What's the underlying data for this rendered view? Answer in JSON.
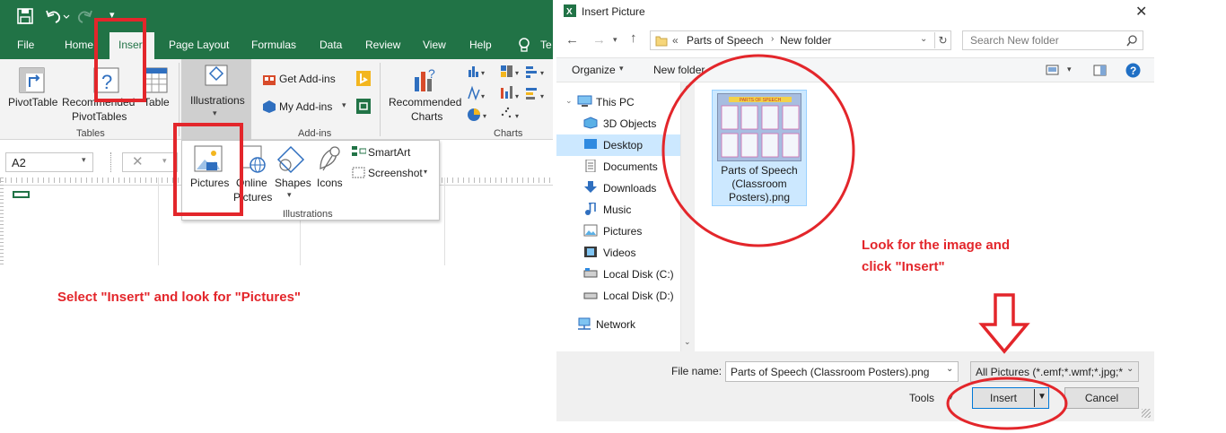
{
  "excel": {
    "tabs": {
      "file": "File",
      "home": "Home",
      "insert": "Insert",
      "page_layout": "Page Layout",
      "formulas": "Formulas",
      "data": "Data",
      "review": "Review",
      "view": "View",
      "help": "Help",
      "tell_me": "Te"
    },
    "ribbon": {
      "pivot_table": "PivotTable",
      "recommended_pivot_line1": "Recommended",
      "recommended_pivot_line2": "PivotTables",
      "table": "Table",
      "tables_group": "Tables",
      "illustrations": "Illustrations",
      "get_addins": "Get Add-ins",
      "my_addins": "My Add-ins",
      "addins_group": "Add-ins",
      "recommended_charts_line1": "Recommended",
      "recommended_charts_line2": "Charts",
      "charts_group": "Charts"
    },
    "name_box": "A2",
    "illustrations_panel": {
      "pictures": "Pictures",
      "online_line1": "Online",
      "online_line2": "Pictures",
      "shapes": "Shapes",
      "icons": "Icons",
      "smartart": "SmartArt",
      "screenshot": "Screenshot",
      "group_label": "Illustrations"
    }
  },
  "annotations": {
    "left_instruction": "Select \"Insert\" and look for \"Pictures\"",
    "right_line1": "Look for the image and",
    "right_line2": "click \"Insert\"",
    "color": "#e3262b"
  },
  "dialog": {
    "title": "Insert Picture",
    "breadcrumb_prefix": "«",
    "breadcrumb_1": "Parts of Speech",
    "breadcrumb_2": "New folder",
    "search_placeholder": "Search New folder",
    "organize": "Organize",
    "new_folder": "New folder",
    "nav": {
      "this_pc": "This PC",
      "objects_3d": "3D Objects",
      "desktop": "Desktop",
      "documents": "Documents",
      "downloads": "Downloads",
      "music": "Music",
      "pictures": "Pictures",
      "videos": "Videos",
      "local_c": "Local Disk (C:)",
      "local_d": "Local Disk (D:)",
      "network": "Network"
    },
    "file": {
      "name_line1": "Parts of Speech",
      "name_line2": "(Classroom",
      "name_line3": "Posters).png",
      "thumb_title": "PARTS OF SPEECH"
    },
    "file_name_label": "File name:",
    "file_name_value": "Parts of Speech (Classroom Posters).png",
    "file_type_value": "All Pictures (*.emf;*.wmf;*.jpg;*",
    "tools": "Tools",
    "insert": "Insert",
    "cancel": "Cancel"
  },
  "colors": {
    "excel_green": "#217346",
    "selection_blue": "#cce8ff",
    "accent_blue": "#0078d7"
  }
}
